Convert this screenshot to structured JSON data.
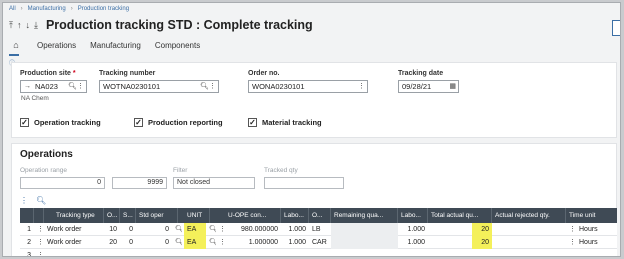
{
  "breadcrumb": [
    "All",
    "Manufacturing",
    "Production tracking"
  ],
  "title": "Production tracking STD : Complete tracking",
  "tabs": [
    "Operations",
    "Manufacturing",
    "Components"
  ],
  "header": {
    "production_site_label": "Production site",
    "production_site_value": "NA023",
    "production_site_desc": "NA Chem",
    "tracking_number_label": "Tracking number",
    "tracking_number_value": "WOTNA0230101",
    "order_no_label": "Order no.",
    "order_no_value": "WONA0230101",
    "tracking_date_label": "Tracking date",
    "tracking_date_value": "09/28/21"
  },
  "checkboxes": [
    "Operation tracking",
    "Production reporting",
    "Material tracking"
  ],
  "operations": {
    "title": "Operations",
    "operation_range_label": "Operation range",
    "range_from": "0",
    "range_to": "9999",
    "filter_label": "Filter",
    "filter_value": "Not closed",
    "tracked_qty_label": "Tracked qty",
    "tracked_qty_value": "",
    "columns": [
      "Tracking type",
      "O...",
      "S...",
      "Std oper",
      "UNIT",
      "U-OPE con...",
      "Labo...",
      "O...",
      "Remaining qua...",
      "Labo...",
      "Total actual qu...",
      "Actual rejected qty.",
      "Time unit"
    ],
    "rows": [
      {
        "num": "1",
        "tracking_type": "Work order",
        "op": "10",
        "s": "0",
        "std": "0",
        "unit": "EA",
        "conv": "980.000000",
        "labo": "1.000",
        "o": "LB",
        "remaining": "",
        "labo2": "1.000",
        "total": "20",
        "rejected": "",
        "time_unit": "Hours"
      },
      {
        "num": "2",
        "tracking_type": "Work order",
        "op": "20",
        "s": "0",
        "std": "0",
        "unit": "EA",
        "conv": "1.000000",
        "labo": "1.000",
        "o": "CAR",
        "remaining": "",
        "labo2": "1.000",
        "total": "20",
        "rejected": "",
        "time_unit": "Hours"
      }
    ],
    "empty_row_num": "3"
  },
  "colors": {
    "grid_header": "#3f4a55",
    "highlight": "#f4f05a",
    "accent": "#3b6ea5",
    "required": "#d0021b"
  }
}
